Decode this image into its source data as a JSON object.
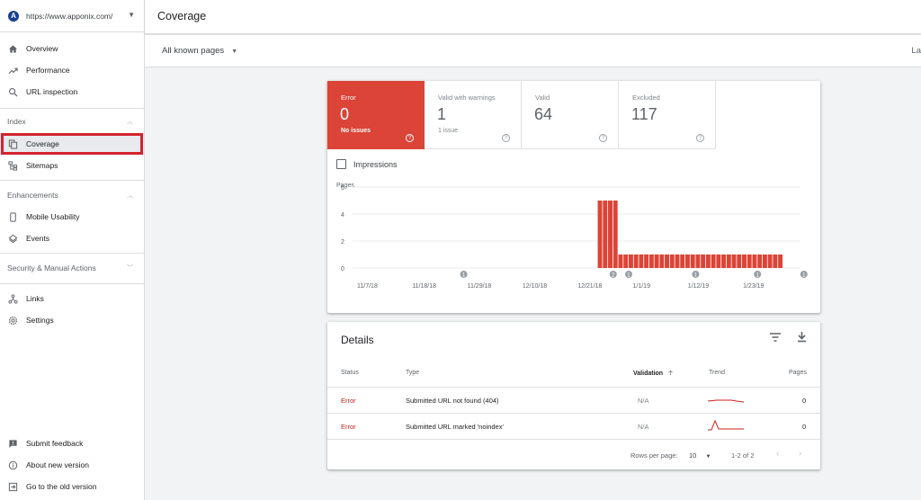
{
  "sidebar": {
    "property_url": "https://www.apponix.com/",
    "property_logo": "A",
    "items_top": [
      {
        "label": "Overview",
        "icon": "home-icon"
      },
      {
        "label": "Performance",
        "icon": "trending-up-icon"
      },
      {
        "label": "URL inspection",
        "icon": "search-icon"
      }
    ],
    "index_section": "Index",
    "index_items": [
      {
        "label": "Coverage",
        "icon": "copy-icon"
      },
      {
        "label": "Sitemaps",
        "icon": "sitemap-icon"
      }
    ],
    "enhancements_section": "Enhancements",
    "enhancement_items": [
      {
        "label": "Mobile Usability",
        "icon": "phone-icon"
      },
      {
        "label": "Events",
        "icon": "layers-icon"
      }
    ],
    "security_section": "Security & Manual Actions",
    "other_items": [
      {
        "label": "Links",
        "icon": "links-icon"
      },
      {
        "label": "Settings",
        "icon": "gear-icon"
      }
    ],
    "bottom_items": [
      {
        "label": "Submit feedback",
        "icon": "feedback-icon"
      },
      {
        "label": "About new version",
        "icon": "info-icon"
      },
      {
        "label": "Go to the old version",
        "icon": "exit-icon"
      }
    ]
  },
  "header": {
    "title": "Coverage"
  },
  "filter": {
    "dropdown_label": "All known pages",
    "right_text": "La"
  },
  "stats": [
    {
      "label": "Error",
      "value": "0",
      "sub": "No issues"
    },
    {
      "label": "Valid with warnings",
      "value": "1",
      "sub": "1 issue"
    },
    {
      "label": "Valid",
      "value": "64",
      "sub": ""
    },
    {
      "label": "Excluded",
      "value": "117",
      "sub": ""
    }
  ],
  "colors": {
    "error_red": "#db4437",
    "highlight_box": "#d3232f"
  },
  "impressions_label": "Impressions",
  "chart_data": {
    "type": "bar",
    "ylabel": "Pages",
    "yticks": [
      "0",
      "2",
      "4",
      "6"
    ],
    "ylim": [
      0,
      6
    ],
    "xticks": [
      "11/7/18",
      "11/18/18",
      "11/29/18",
      "12/10/18",
      "12/21/18",
      "1/1/19",
      "1/12/19",
      "1/23/19"
    ],
    "bar_start_day_index": 46,
    "values": [
      5,
      5,
      5,
      5,
      1,
      1,
      1,
      1,
      1,
      1,
      1,
      1,
      1,
      1,
      1,
      1,
      1,
      1,
      1,
      1,
      1,
      1,
      1,
      1,
      1,
      1,
      1,
      1,
      1,
      1,
      1,
      1,
      1,
      1,
      1,
      1
    ],
    "annotations": [
      {
        "day_index": 20,
        "label": "1"
      },
      {
        "day_index": 49,
        "label": "2"
      },
      {
        "day_index": 52,
        "label": "1"
      },
      {
        "day_index": 65,
        "label": "1"
      },
      {
        "day_index": 77,
        "label": "1"
      },
      {
        "day_index": 86,
        "label": "1"
      }
    ],
    "bar_color": "#db4437"
  },
  "details": {
    "title": "Details",
    "columns": {
      "status": "Status",
      "type": "Type",
      "validation": "Validation",
      "trend": "Trend",
      "pages": "Pages"
    },
    "rows": [
      {
        "status": "Error",
        "type": "Submitted URL not found (404)",
        "validation": "N/A",
        "pages": "0"
      },
      {
        "status": "Error",
        "type": "Submitted URL marked 'noindex'",
        "validation": "N/A",
        "pages": "0"
      }
    ],
    "rows_per_page_label": "Rows per page:",
    "rows_per_page": "10",
    "range": "1-2 of 2"
  }
}
